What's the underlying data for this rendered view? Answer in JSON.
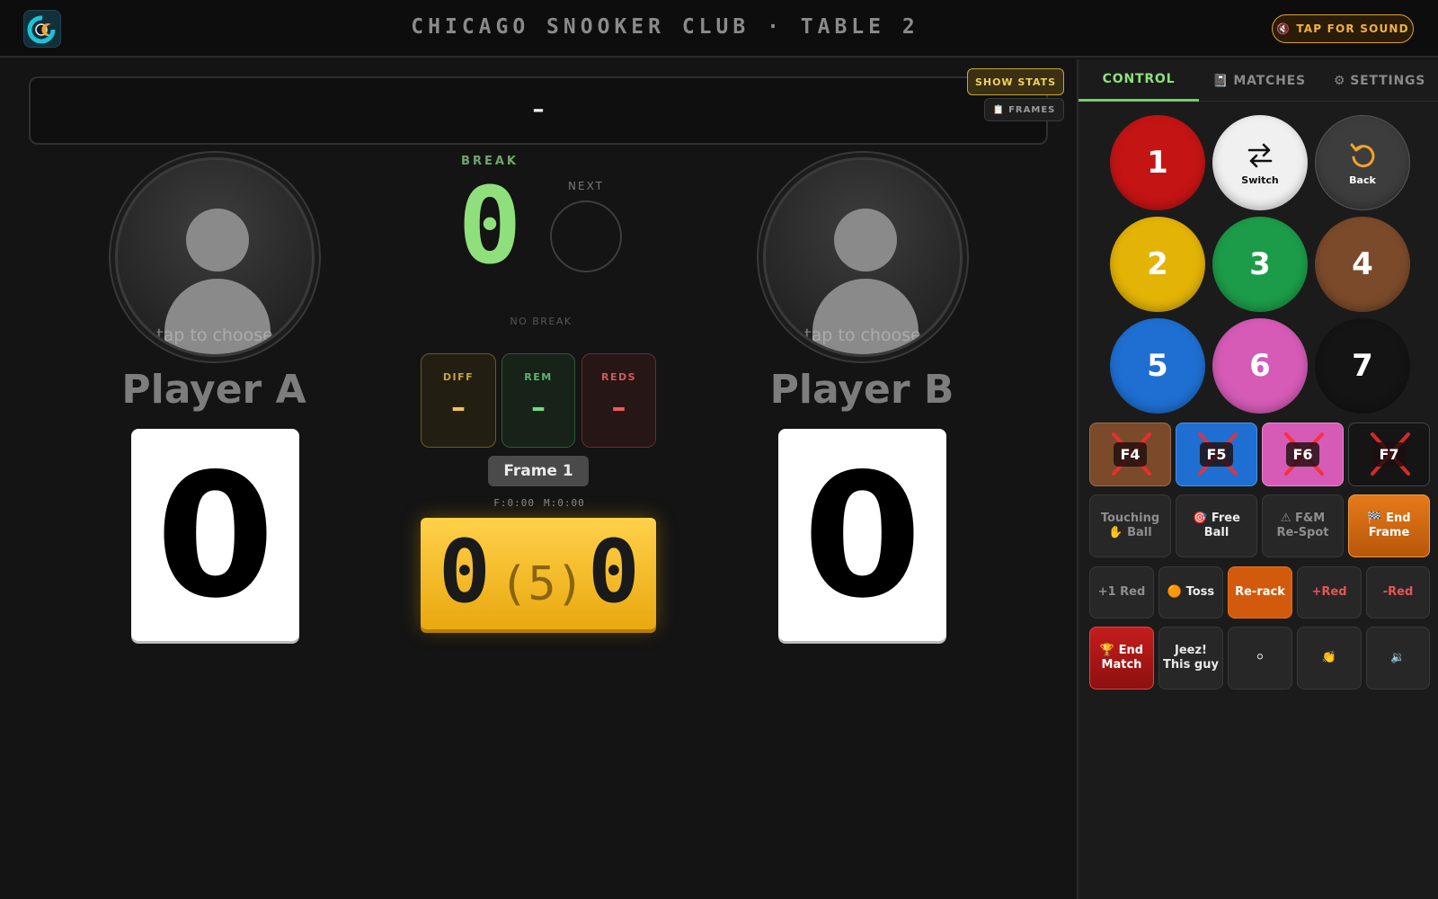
{
  "header": {
    "title": "CHICAGO SNOOKER CLUB · TABLE 2",
    "sound_button": "TAP FOR SOUND",
    "sound_icon": "🔇"
  },
  "frames_bar": {
    "value": "–",
    "show_stats": "SHOW STATS",
    "frames_button": "FRAMES",
    "frames_icon": "📋"
  },
  "players": [
    {
      "name": "Player A",
      "score": "0",
      "avatar_hint": "tap to choose"
    },
    {
      "name": "Player B",
      "score": "0",
      "avatar_hint": "tap to choose"
    }
  ],
  "break": {
    "label": "BREAK",
    "value": "0",
    "next_label": "NEXT",
    "status": "NO BREAK"
  },
  "stats": {
    "diff": {
      "label": "DIFF",
      "value": "–"
    },
    "rem": {
      "label": "REM",
      "value": "–"
    },
    "reds": {
      "label": "REDS",
      "value": "–"
    }
  },
  "frame": {
    "label": "Frame 1",
    "frame_timer": "F:0:00",
    "match_timer": "M:0:00",
    "score_a": "0",
    "best_of": "(5)",
    "score_b": "0"
  },
  "panel": {
    "tabs": [
      {
        "label": "CONTROL",
        "icon": ""
      },
      {
        "label": "MATCHES",
        "icon": "📓"
      },
      {
        "label": "SETTINGS",
        "icon": "⚙"
      }
    ],
    "balls": [
      {
        "label": "1",
        "color": "#c41414"
      },
      {
        "label": "Switch",
        "color": "#f0f0f0",
        "icon": "switch-arrows-icon"
      },
      {
        "label": "Back",
        "color": "#3d3d3d",
        "icon": "undo-icon"
      },
      {
        "label": "2",
        "color": "#e3b306"
      },
      {
        "label": "3",
        "color": "#1c9c48"
      },
      {
        "label": "4",
        "color": "#7b4a2b"
      },
      {
        "label": "5",
        "color": "#1e6fd1"
      },
      {
        "label": "6",
        "color": "#d55bb6"
      },
      {
        "label": "7",
        "color": "#141414"
      }
    ],
    "fouls": [
      {
        "label": "F4",
        "color": "#7b4a2b"
      },
      {
        "label": "F5",
        "color": "#1e6fd1"
      },
      {
        "label": "F6",
        "color": "#d55bb6"
      },
      {
        "label": "F7",
        "color": "#151515"
      }
    ],
    "actions": {
      "touching_ball": {
        "line1": "Touching",
        "line2": "Ball",
        "icon": "✋"
      },
      "free_ball": {
        "line1": "Free",
        "line2": "Ball",
        "icon": "🎯"
      },
      "fm_respot": {
        "line1": "F&M",
        "line2": "Re-Spot",
        "icon": "⚠"
      },
      "end_frame": {
        "line1": "End",
        "line2": "Frame",
        "icon": "🏁"
      },
      "plus_one_red": "+1 Red",
      "toss": {
        "label": "Toss",
        "icon": "🟠"
      },
      "rerack": "Re-rack",
      "plus_red": "+Red",
      "minus_red": "-Red",
      "end_match": {
        "line1": "End",
        "line2": "Match",
        "icon": "🏆"
      },
      "jeez": {
        "line1": "Jeez!",
        "line2": "This guy"
      },
      "cue_ball_icon": "⚪",
      "clap_icon": "👏",
      "speaker_icon": "🔉"
    }
  }
}
